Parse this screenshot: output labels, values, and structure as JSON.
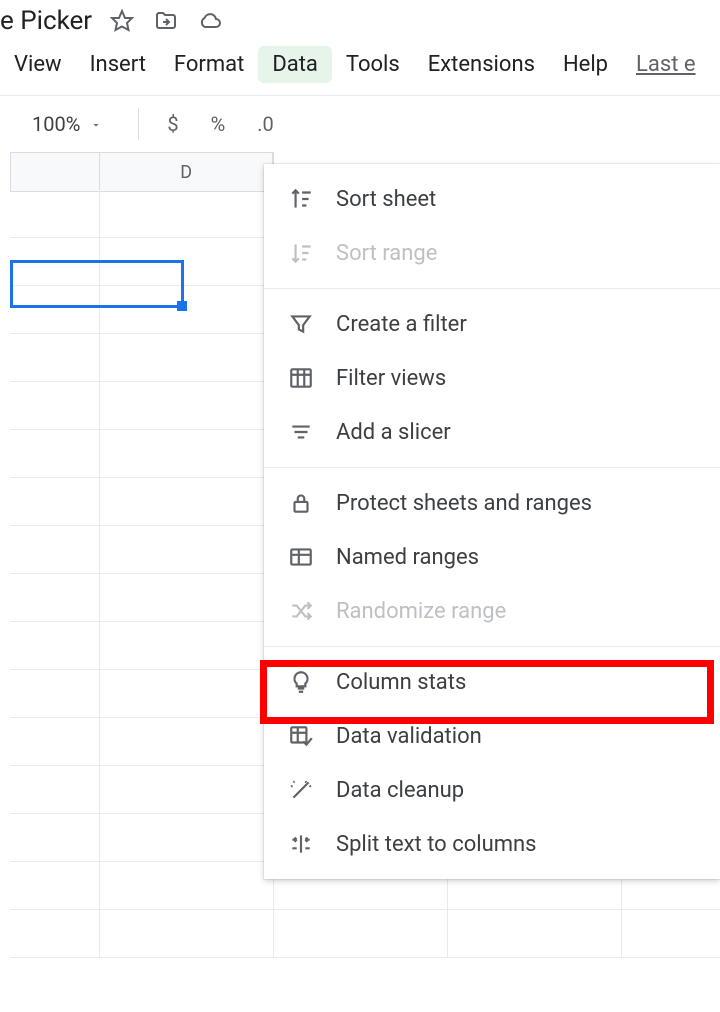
{
  "title": "e Picker",
  "menubar": {
    "view": "View",
    "insert": "Insert",
    "format": "Format",
    "data": "Data",
    "tools": "Tools",
    "extensions": "Extensions",
    "help": "Help",
    "last_edit": "Last e"
  },
  "toolbar": {
    "zoom": "100%",
    "currency": "$",
    "percent": "%",
    "decimal": ".0"
  },
  "column_header": "D",
  "data_menu": {
    "sort_sheet": "Sort sheet",
    "sort_range": "Sort range",
    "create_filter": "Create a filter",
    "filter_views": "Filter views",
    "add_slicer": "Add a slicer",
    "protect": "Protect sheets and ranges",
    "named_ranges": "Named ranges",
    "randomize": "Randomize range",
    "column_stats": "Column stats",
    "data_validation": "Data validation",
    "data_cleanup": "Data cleanup",
    "split_text": "Split text to columns"
  }
}
